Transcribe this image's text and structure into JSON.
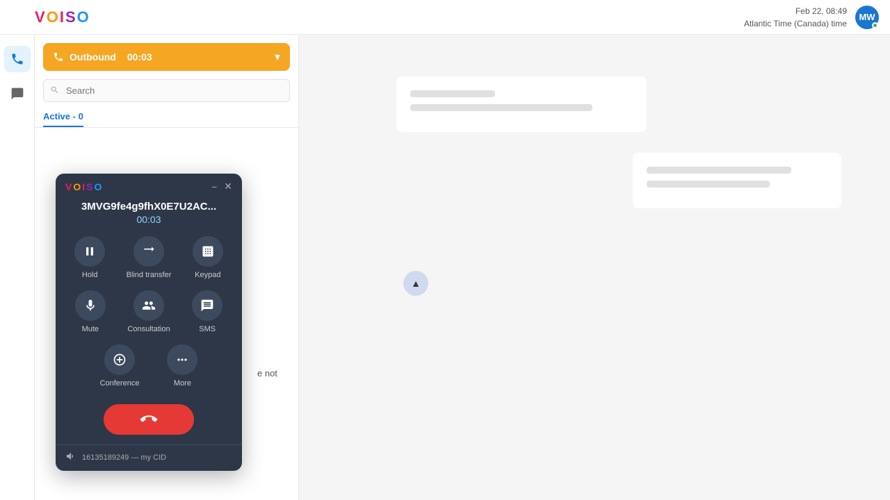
{
  "header": {
    "logo": "VOISO",
    "date": "Feb 22, 08:49",
    "timezone": "Atlantic Time (Canada) time",
    "user_initials": "MW"
  },
  "sidebar": {
    "icons": [
      {
        "name": "phone-icon",
        "symbol": "↻",
        "active": true
      },
      {
        "name": "message-icon",
        "symbol": "▭",
        "active": false
      }
    ]
  },
  "left_panel": {
    "outbound": {
      "label": "Outbound",
      "timer": "00:03",
      "chevron": "▾"
    },
    "search": {
      "placeholder": "Search"
    },
    "active_tab": {
      "label": "Active - 0"
    }
  },
  "call_popup": {
    "logo": "VOISO",
    "minimize_label": "−",
    "close_label": "✕",
    "caller_id": "3MVG9fe4g9fhX0E7U2AC...",
    "timer": "00:03",
    "actions_row1": [
      {
        "name": "hold-btn",
        "label": "Hold",
        "icon": "⏸"
      },
      {
        "name": "blind-transfer-btn",
        "label": "Blind transfer",
        "icon": "↪"
      },
      {
        "name": "keypad-btn",
        "label": "Keypad",
        "icon": "⠿"
      }
    ],
    "actions_row2": [
      {
        "name": "mute-btn",
        "label": "Mute",
        "icon": "🎤"
      },
      {
        "name": "consultation-btn",
        "label": "Consultation",
        "icon": "👥"
      },
      {
        "name": "sms-btn",
        "label": "SMS",
        "icon": "💬"
      }
    ],
    "actions_row3": [
      {
        "name": "conference-btn",
        "label": "Conference",
        "icon": "➕👥"
      },
      {
        "name": "more-btn",
        "label": "More",
        "icon": "•••"
      }
    ],
    "end_call_icon": "✆",
    "footer_volume_icon": "🔊",
    "footer_cid": "16135189249 — my CID"
  },
  "partial_text": "e not",
  "skeleton_cards": [
    {
      "lines": [
        {
          "type": "short"
        },
        {
          "type": "long"
        },
        {
          "type": "medium"
        }
      ]
    },
    {
      "lines": [
        {
          "type": "medium"
        },
        {
          "type": "med2"
        }
      ]
    }
  ]
}
